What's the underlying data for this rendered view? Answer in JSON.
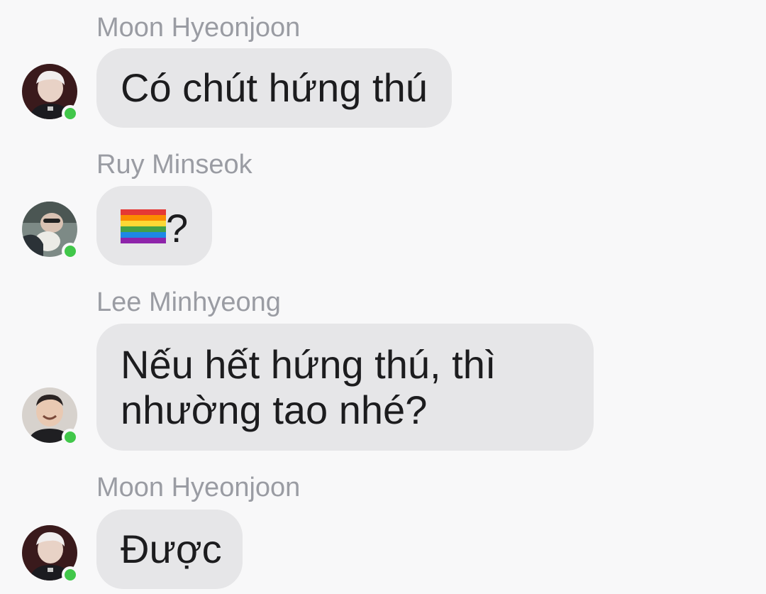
{
  "messages": [
    {
      "sender": "Moon Hyeonjoon",
      "text": "Có chút hứng thú",
      "avatar_icon": "user-avatar-photo",
      "online": true
    },
    {
      "sender": "Ruy Minseok",
      "text": "?",
      "emoji": "rainbow-flag-icon",
      "avatar_icon": "user-avatar-photo",
      "online": true
    },
    {
      "sender": "Lee Minhyeong",
      "text_line1": "Nếu hết hứng thú, thì",
      "text_line2": "nhường tao nhé?",
      "avatar_icon": "user-avatar-photo",
      "online": true
    },
    {
      "sender": "Moon Hyeonjoon",
      "text": "Được",
      "avatar_icon": "user-avatar-photo",
      "online": true
    }
  ],
  "colors": {
    "background": "#f8f8f9",
    "bubble": "#e6e6e8",
    "sender_text": "#9a9ca3",
    "message_text": "#1c1c1e",
    "online_dot": "#41c74a"
  }
}
